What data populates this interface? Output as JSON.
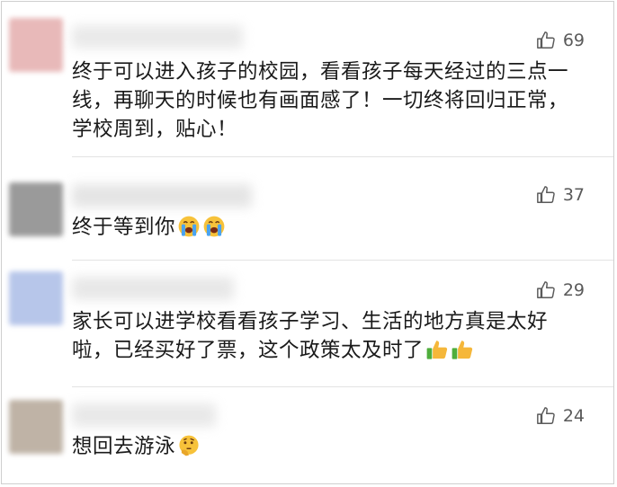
{
  "comments": [
    {
      "likes": "69",
      "text": "终于可以进入孩子的校园，看看孩子每天经过的三点一线，再聊天的时候也有画面感了！一切终将回归正常，学校周到，贴心！",
      "avatar_color": "#e8b9b9",
      "emojis": []
    },
    {
      "likes": "37",
      "text": "终于等到你",
      "avatar_color": "#9a9a9a",
      "emojis": [
        "loudly-crying-face",
        "loudly-crying-face"
      ]
    },
    {
      "likes": "29",
      "text": "家长可以进学校看看孩子学习、生活的地方真是太好啦，已经买好了票，这个政策太及时了",
      "avatar_color": "#b7c6ea",
      "emojis": [
        "thumbs-up",
        "thumbs-up"
      ]
    },
    {
      "likes": "24",
      "text": "想回去游泳",
      "avatar_color": "#bfb3a6",
      "emojis": [
        "thinking-face"
      ]
    }
  ],
  "colors": {
    "text": "#1a1a1a",
    "like_text": "#5a5a5a",
    "divider": "#e3e3e3",
    "border": "#cfcfcf"
  }
}
